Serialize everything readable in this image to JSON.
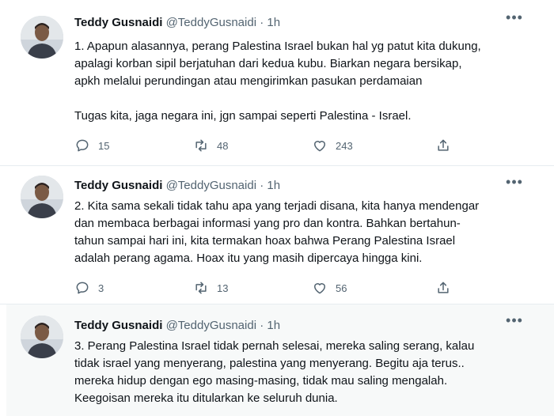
{
  "tweets": [
    {
      "name": "Teddy Gusnaidi",
      "handle": "@TeddyGusnaidi",
      "dot": "·",
      "time": "1h",
      "more": "•••",
      "text": "1. Apapun alasannya, perang Palestina Israel bukan hal yg patut kita dukung,\napalagi korban sipil berjatuhan dari kedua kubu. Biarkan negara bersikap,\napkh melalui perundingan atau mengirimkan pasukan perdamaian\n\nTugas kita, jaga negara ini, jgn sampai seperti Palestina - Israel.",
      "replies": "15",
      "retweets": "48",
      "likes": "243"
    },
    {
      "name": "Teddy Gusnaidi",
      "handle": "@TeddyGusnaidi",
      "dot": "·",
      "time": "1h",
      "more": "•••",
      "text": "2. Kita sama sekali tidak tahu apa yang terjadi disana, kita hanya mendengar\ndan membaca berbagai informasi yang pro dan kontra. Bahkan bertahun-\ntahun sampai hari ini, kita termakan hoax bahwa Perang Palestina Israel\nadalah perang agama. Hoax itu yang masih dipercaya hingga kini.",
      "replies": "3",
      "retweets": "13",
      "likes": "56"
    },
    {
      "name": "Teddy Gusnaidi",
      "handle": "@TeddyGusnaidi",
      "dot": "·",
      "time": "1h",
      "more": "•••",
      "text": "3. Perang Palestina Israel tidak pernah selesai, mereka saling serang, kalau\ntidak israel yang menyerang, palestina yang menyerang. Begitu aja terus..\nmereka hidup dengan ego masing-masing, tidak mau saling mengalah.\nKeegoisan mereka itu ditularkan ke seluruh dunia."
    }
  ],
  "icons": {
    "reply": "reply-icon",
    "retweet": "retweet-icon",
    "like": "heart-icon",
    "share": "share-icon",
    "more": "more-icon"
  },
  "colors": {
    "text": "#0f1419",
    "secondary": "#536471",
    "divider": "#e6ecf0",
    "highlight_bg": "#f7f9f9"
  }
}
